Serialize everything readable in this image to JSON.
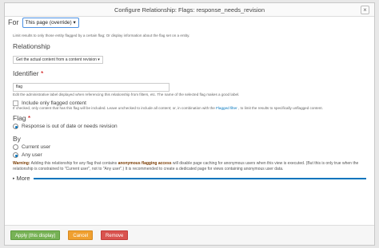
{
  "dialog": {
    "title": "Configure Relationship: Flags: response_needs_revision",
    "close_glyph": "×"
  },
  "for_row": {
    "label": "For",
    "select_value": "This page (override)"
  },
  "intro_help": "Limit results to only those entity flagged by a certain flag; Or display information about the flag set on a entity.",
  "relationship": {
    "heading": "Relationship",
    "select_value": "Get the actual content from a content revision"
  },
  "identifier": {
    "label": "Identifier",
    "required_mark": "*",
    "value": "flag",
    "help": "Edit the administrative label displayed when referencing this relationship from filters, etc. The name of the selected flag makes a good label."
  },
  "include_flagged": {
    "label": "Include only flagged content",
    "help_prefix": "If checked, only content that has this flag will be included. Leave unchecked to include all content; or, in combination with the",
    "help_link": "Flagged filter",
    "help_suffix": ", to limit the results to specifically unflagged content."
  },
  "flag": {
    "heading": "Flag",
    "required_mark": "*",
    "option": "Response is out of date or needs revision"
  },
  "by": {
    "heading": "By",
    "options": [
      "Current user",
      "Any user"
    ],
    "selected": "Any user"
  },
  "warning": {
    "label": "Warning:",
    "text_before": " Adding this relationship for any flag that contains ",
    "bold": "anonymous flagging access",
    "text_after": " will disable page caching for anonymous users when this view is executed. (But this is only true when the relationship is constrained to \"Current user\", not to \"Any user\".) It is recommended to create a dedicated page for views containing anonymous user data."
  },
  "more": {
    "label": "More",
    "toggle_glyph": "▸"
  },
  "footer": {
    "apply": "Apply (this display)",
    "cancel": "Cancel",
    "remove": "Remove"
  },
  "colors": {
    "apply": "#77b255",
    "cancel": "#f0a030",
    "remove": "#d9534f",
    "link": "#0074bd"
  }
}
